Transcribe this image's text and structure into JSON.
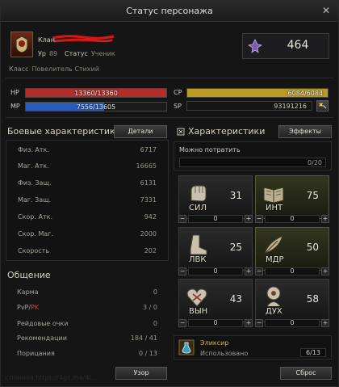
{
  "window": {
    "title": "Статус персонажа",
    "close": "✕"
  },
  "header": {
    "clan_label": "Клан",
    "level_label": "Ур",
    "level_value": "89",
    "status_label": "Статус",
    "status_value": "Ученик",
    "power_value": "464",
    "class_label": "Класс",
    "class_value": "Повелитель Стихий"
  },
  "bars": {
    "hp": {
      "label": "HP",
      "text": "13360/13360",
      "fraction": 1.0,
      "color": "#b12e2a"
    },
    "mp": {
      "label": "MP",
      "text": "7556/13605",
      "fraction": 0.555,
      "color": "#2b5bb8"
    },
    "cp": {
      "label": "CP",
      "text": "6084/6084",
      "fraction": 1.0,
      "color": "#b89a25"
    },
    "sp": {
      "label": "SP",
      "text": "93191216"
    }
  },
  "combat": {
    "title": "Боевые характеристики",
    "details_button": "Детали",
    "rows": [
      {
        "label": "Физ. Атк.",
        "value": "6717"
      },
      {
        "label": "Маг. Атк.",
        "value": "16665"
      },
      {
        "label": "Физ. Защ.",
        "value": "6131"
      },
      {
        "label": "Маг. Защ.",
        "value": "7331"
      },
      {
        "label": "Скор. Атк.",
        "value": "942"
      },
      {
        "label": "Скор. Маг.",
        "value": "2000"
      },
      {
        "label": "Скорость",
        "value": "202"
      }
    ]
  },
  "social": {
    "title": "Общение",
    "rows": [
      {
        "label": "Карма",
        "value": "0"
      },
      {
        "label_pvp": "PvP",
        "label_sep": "/",
        "label_pk": "PK",
        "value": "3 / 0"
      },
      {
        "label": "Рейдовые очки",
        "value": "0"
      },
      {
        "label": "Рекомендации",
        "value": "184 / 41"
      },
      {
        "label": "Порицания",
        "value": "0 / 13"
      }
    ]
  },
  "characteristics": {
    "title": "Характеристики",
    "effects_button": "Эффекты",
    "can_spend_label": "Можно потратить",
    "can_spend_value": "0/20",
    "stats": [
      {
        "name": "СИЛ",
        "value": "31",
        "alloc": "0",
        "icon": "fist-icon"
      },
      {
        "name": "ИНТ",
        "value": "75",
        "alloc": "0",
        "icon": "book-icon"
      },
      {
        "name": "ЛВК",
        "value": "25",
        "alloc": "0",
        "icon": "boot-icon"
      },
      {
        "name": "МДР",
        "value": "50",
        "alloc": "0",
        "icon": "feather-icon"
      },
      {
        "name": "ВЫН",
        "value": "43",
        "alloc": "0",
        "icon": "heart-icon"
      },
      {
        "name": "ДУХ",
        "value": "58",
        "alloc": "0",
        "icon": "spirit-icon"
      }
    ],
    "elixir_label": "Эликсир",
    "elixir_used_label": "Использовано",
    "elixir_used_value": "6/13"
  },
  "footer": {
    "pattern_button": "Узор",
    "reset_button": "Сброс",
    "watermark": "спонная https://4gc.me/4l..."
  },
  "colors": {
    "accent_gold": "#b89a25",
    "hp": "#b12e2a",
    "mp": "#2b5bb8",
    "pk": "#d04040"
  }
}
